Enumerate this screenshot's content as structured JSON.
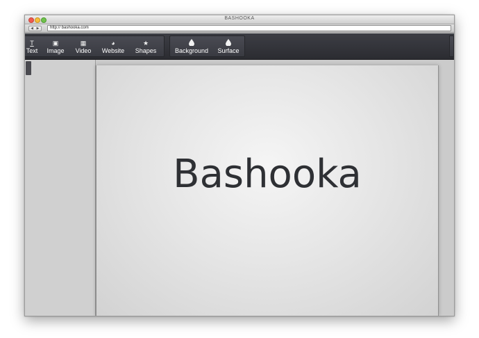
{
  "window": {
    "title": "BASHOOKA",
    "url": "http:// bashooka.com"
  },
  "nav": {
    "back_icon": "triangle-left-icon",
    "forward_icon": "triangle-right-icon",
    "back_glyph": "◀",
    "forward_glyph": "▶"
  },
  "toolbar": {
    "insert_group": [
      {
        "label": "Text",
        "icon": "text-icon",
        "glyph": "T"
      },
      {
        "label": "Image",
        "icon": "image-icon",
        "glyph": "▣"
      },
      {
        "label": "Video",
        "icon": "film-icon",
        "glyph": "▦"
      },
      {
        "label": "Website",
        "icon": "globe-icon",
        "glyph": "◕"
      },
      {
        "label": "Shapes",
        "icon": "star-icon",
        "glyph": "★"
      }
    ],
    "style_group": [
      {
        "label": "Background",
        "icon": "drop-icon",
        "glyph": "💧"
      },
      {
        "label": "Surface",
        "icon": "drop-icon",
        "glyph": "💧"
      }
    ]
  },
  "canvas": {
    "headline": "Bashooka"
  },
  "colors": {
    "toolbar_bg": "#33343a",
    "canvas_bg": "#e6e6e6",
    "headline_text": "#2e3034"
  }
}
